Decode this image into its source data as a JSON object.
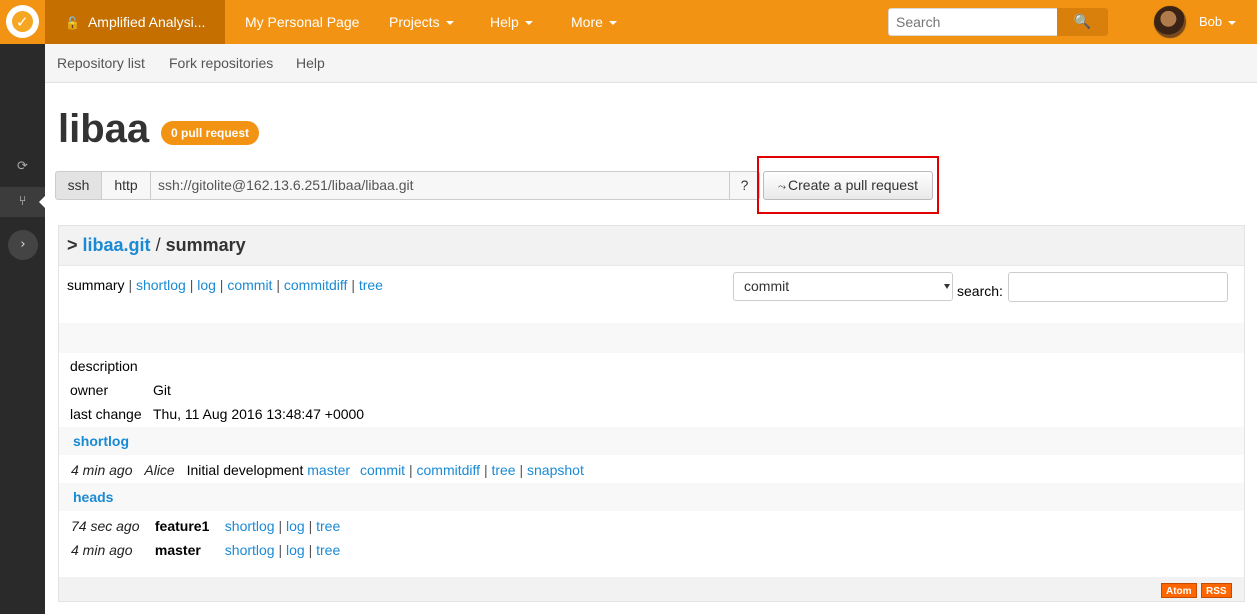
{
  "topbar": {
    "project_name": "Amplified Analysi...",
    "nav": [
      "My Personal Page",
      "Projects",
      "Help",
      "More"
    ],
    "search_placeholder": "Search",
    "user_name": "Bob",
    "accent_color": "#f39314"
  },
  "subnav": {
    "items": [
      "Repository list",
      "Fork repositories",
      "Help"
    ]
  },
  "repo": {
    "title": "libaa",
    "pr_badge": "0 pull request"
  },
  "clone": {
    "ssh_label": "ssh",
    "http_label": "http",
    "url": "ssh://gitolite@162.13.6.251/libaa/libaa.git",
    "help_label": "?",
    "create_pr_label": "Create a pull request"
  },
  "summary": {
    "prefix": ">",
    "repo_link": "libaa.git",
    "slash": "/",
    "page": "summary",
    "nav": {
      "current": "summary",
      "links": [
        "shortlog",
        "log",
        "commit",
        "commitdiff",
        "tree"
      ]
    },
    "search_type": "commit",
    "search_label": "search:",
    "meta": [
      {
        "key": "description",
        "value": ""
      },
      {
        "key": "owner",
        "value": "Git"
      },
      {
        "key": "last change",
        "value": "Thu, 11 Aug 2016 13:48:47 +0000"
      }
    ],
    "shortlog_title": "shortlog",
    "shortlog": [
      {
        "age": "4 min ago",
        "author": "Alice",
        "message": "Initial development",
        "ref": "master",
        "links": [
          "commit",
          "commitdiff",
          "tree",
          "snapshot"
        ]
      }
    ],
    "heads_title": "heads",
    "heads": [
      {
        "age": "74 sec ago",
        "name": "feature1",
        "links": [
          "shortlog",
          "log",
          "tree"
        ]
      },
      {
        "age": "4 min ago",
        "name": "master",
        "links": [
          "shortlog",
          "log",
          "tree"
        ]
      }
    ],
    "feeds": [
      "Atom",
      "RSS"
    ]
  }
}
